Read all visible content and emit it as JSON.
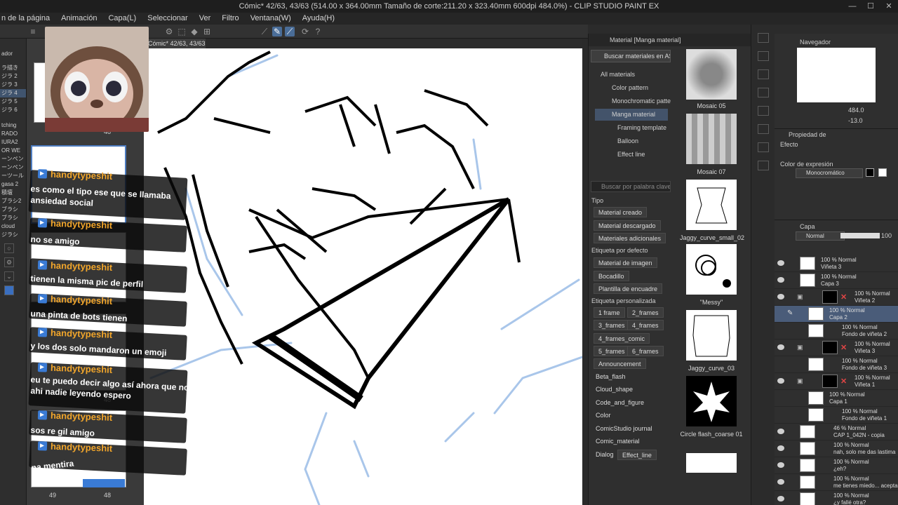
{
  "window": {
    "title": "Cómic* 42/63, 43/63 (514.00 x 364.00mm Tamaño de corte:211.20 x 323.40mm 600dpi 484.0%) - CLIP STUDIO PAINT EX",
    "controls": [
      "—",
      "☐",
      "✕"
    ]
  },
  "menu": [
    "n de la página",
    "Animación",
    "Capa(L)",
    "Seleccionar",
    "Ver",
    "Filtro",
    "Ventana(W)",
    "Ayuda(H)"
  ],
  "left_pane": {
    "items": [
      "ador",
      "ラ描き",
      "ジラ 2",
      "ジラ 3",
      "ジラ 4",
      "ジラ 5",
      "ジラ 6",
      "tching",
      "RADO",
      "IURA2",
      "OR WE",
      "ーンペン",
      "ーンペン",
      "ーツール",
      "gasa 2",
      "積壇",
      "ブラシ2",
      "ブラシ",
      "ブラシ",
      "cloud",
      "ジラシ"
    ]
  },
  "canvas": {
    "tab": "Cómic* 42/63, 43/63"
  },
  "pages": {
    "numbers": [
      "48",
      "49",
      "48",
      "48",
      "49",
      "48"
    ]
  },
  "chat": {
    "messages": [
      {
        "user": "handytypeshit",
        "text": [
          "es como el tipo ese que se llamaba",
          "ansiedad social"
        ]
      },
      {
        "user": "handytypeshit",
        "text": [
          "no se amigo"
        ]
      },
      {
        "user": "handytypeshit",
        "text": [
          "tienen la misma pic de perfil"
        ]
      },
      {
        "user": "handytypeshit",
        "text": [
          "una pinta de bots tienen"
        ]
      },
      {
        "user": "handytypeshit",
        "text": [
          "y los dos solo mandaron un emoji"
        ]
      },
      {
        "user": "handytypeshit",
        "text": [
          "eu te puedo decir algo así ahora que no",
          "ahi nadie leyendo espero"
        ]
      },
      {
        "user": "handytypeshit",
        "text": [
          "sos re gil amigo"
        ]
      },
      {
        "user": "handytypeshit",
        "text": [
          "na mentira"
        ]
      }
    ]
  },
  "material_panel": {
    "title": "Material [Manga material]",
    "assets_button": "Buscar materiales en ASSETS",
    "tree": [
      "All materials",
      "Color pattern",
      "Monochromatic patte",
      "Manga material",
      "Framing template",
      "Balloon",
      "Effect line"
    ],
    "search_placeholder": "Buscar por palabra clave",
    "tipo_label": "Tipo",
    "tipo": [
      "Material creado",
      "Material descargado",
      "Materiales adicionales"
    ],
    "default_label": "Etiqueta por defecto",
    "defaults": [
      "Material de imagen",
      "Bocadillo",
      "Plantilla de encuadre"
    ],
    "custom_label": "Etiqueta personalizada",
    "custom": [
      [
        "1 frame",
        "2_frames"
      ],
      [
        "3_frames",
        "4_frames"
      ],
      [
        "4_frames_comic"
      ],
      [
        "5_frames",
        "6_frames"
      ],
      [
        "Announcement"
      ],
      [
        "Beta_flash"
      ],
      [
        "Cloud_shape"
      ],
      [
        "Code_and_figure"
      ],
      [
        "Color"
      ],
      [
        "ComicStudio journal"
      ],
      [
        "Comic_material"
      ],
      [
        "Dialog",
        "Effect_line"
      ]
    ],
    "materials": [
      "Mosaic 05",
      "Mosaic 07",
      "Jaggy_curve_small_02",
      "\"Messy\"",
      "Jaggy_curve_03",
      "Circle flash_coarse 01"
    ]
  },
  "navigator": {
    "title": "Navegador",
    "zoom": "484.0",
    "rotation": "-13.0"
  },
  "properties": {
    "title": "Propiedad de",
    "effect_label": "Efecto",
    "expression_label": "Color de expresión",
    "expression_value": "Monocromático"
  },
  "layers": {
    "title": "Capa",
    "blend": "Normal",
    "opacity": "100",
    "items": [
      {
        "pct": "100 % Normal",
        "name": "Viñeta 3"
      },
      {
        "pct": "100 % Normal",
        "name": "Capa 3"
      },
      {
        "pct": "100 % Normal",
        "name": "Viñeta 2"
      },
      {
        "pct": "100 % Normal",
        "name": "Capa 2"
      },
      {
        "pct": "100 % Normal",
        "name": "Fondo de viñeta 2"
      },
      {
        "pct": "100 % Normal",
        "name": "Viñeta 3"
      },
      {
        "pct": "100 % Normal",
        "name": "Fondo de viñeta 3"
      },
      {
        "pct": "100 % Normal",
        "name": "Viñeta 1"
      },
      {
        "pct": "100 % Normal",
        "name": "Capa 1"
      },
      {
        "pct": "100 % Normal",
        "name": "Fondo de viñeta 1"
      },
      {
        "pct": "46 % Normal",
        "name": "CAP 1_042N - copia"
      },
      {
        "pct": "100 % Normal",
        "name": "nah, solo me das lastima"
      },
      {
        "pct": "100 % Normal",
        "name": "¿eh?"
      },
      {
        "pct": "100 % Normal",
        "name": "me tienes miedo... acepta"
      },
      {
        "pct": "100 % Normal",
        "name": "¿y fallé otra?"
      }
    ]
  }
}
